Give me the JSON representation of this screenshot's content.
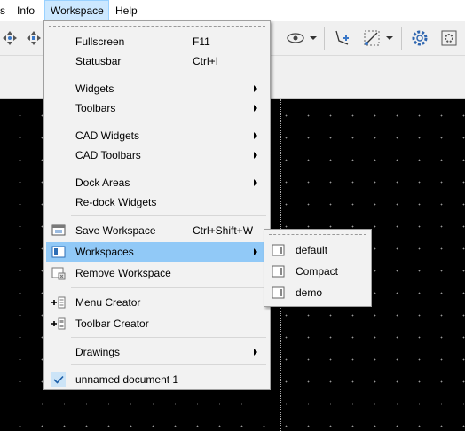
{
  "menubar": {
    "items": [
      {
        "label": "s"
      },
      {
        "label": "Info"
      },
      {
        "label": "Workspace"
      },
      {
        "label": "Help"
      }
    ]
  },
  "toolbar": {
    "icons": [
      "move-icon",
      "move-rotate-icon",
      "visibility-icon",
      "snap-point-icon",
      "snap-line-icon",
      "settings-gear-icon",
      "preferences-icon"
    ]
  },
  "workspace_menu": {
    "items": [
      {
        "label": "Fullscreen",
        "shortcut": "F11"
      },
      {
        "label": "Statusbar",
        "shortcut": "Ctrl+I"
      },
      {
        "label": "Widgets",
        "submenu": true
      },
      {
        "label": "Toolbars",
        "submenu": true
      },
      {
        "label": "CAD Widgets",
        "submenu": true
      },
      {
        "label": "CAD Toolbars",
        "submenu": true
      },
      {
        "label": "Dock Areas",
        "submenu": true
      },
      {
        "label": "Re-dock Widgets"
      },
      {
        "label": "Save Workspace",
        "shortcut": "Ctrl+Shift+W",
        "icon": "save-workspace-icon"
      },
      {
        "label": "Workspaces",
        "submenu": true,
        "highlighted": true,
        "icon": "workspace-icon"
      },
      {
        "label": "Remove Workspace",
        "icon": "remove-workspace-icon"
      },
      {
        "label": "Menu Creator",
        "icon": "menu-creator-icon"
      },
      {
        "label": "Toolbar Creator",
        "icon": "toolbar-creator-icon"
      },
      {
        "label": "Drawings",
        "submenu": true
      },
      {
        "label": "unnamed document 1",
        "checked": true,
        "icon": "check-icon"
      }
    ]
  },
  "workspaces_submenu": {
    "items": [
      {
        "label": "default",
        "icon": "workspace-icon"
      },
      {
        "label": "Compact",
        "icon": "workspace-icon"
      },
      {
        "label": "demo",
        "icon": "workspace-icon"
      }
    ]
  },
  "colors": {
    "highlight": "#91c9f7",
    "menubar_active": "#cce8ff",
    "canvas": "#000000"
  }
}
